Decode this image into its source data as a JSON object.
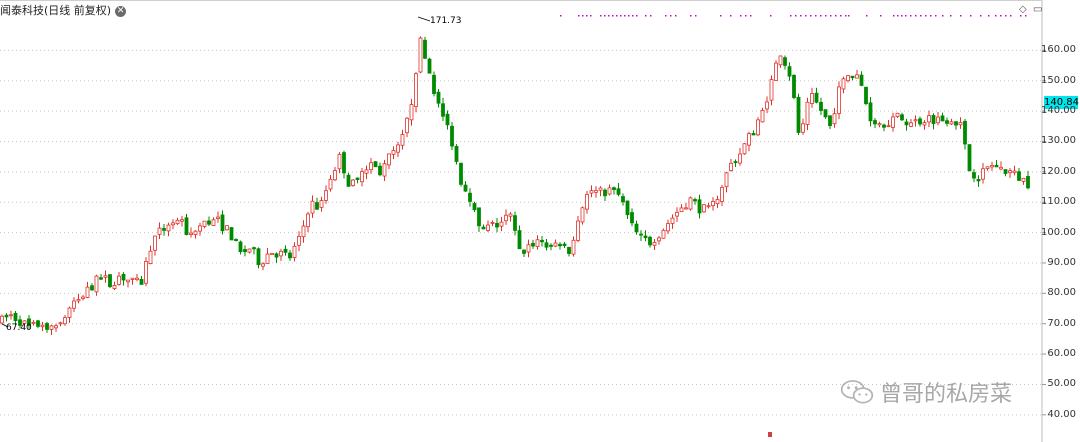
{
  "header": {
    "title": "闻泰科技(日线 前复权)",
    "close_icon": "close-icon"
  },
  "toolbar": {
    "diamond_icon": "diamond-icon",
    "window_icon": "window-icon"
  },
  "price_tag": {
    "value": "140.84",
    "color": "#00e5ee"
  },
  "watermark": {
    "text": "曾哥的私房菜",
    "icon": "wechat-icon"
  },
  "colors": {
    "up": "#e0302a",
    "down": "#008a00",
    "grid": "#c8c8c8",
    "marker": "#cc00cc"
  },
  "chart_data": {
    "type": "candlestick",
    "ylim": [
      35,
      170
    ],
    "yticks": [
      "40.00",
      "50.00",
      "60.00",
      "70.00",
      "80.00",
      "90.00",
      "100.00",
      "110.00",
      "120.00",
      "130.00",
      "140.00",
      "150.00",
      "160.00"
    ],
    "annotations": {
      "high": "171.73",
      "low": "67.40"
    },
    "y_values": {
      "anchors": [
        [
          0,
          70.5
        ],
        [
          10,
          73
        ],
        [
          20,
          71
        ],
        [
          30,
          68.5
        ],
        [
          40,
          70
        ],
        [
          50,
          69.5
        ],
        [
          60,
          70
        ],
        [
          70,
          75
        ],
        [
          80,
          78
        ],
        [
          90,
          82
        ],
        [
          100,
          85
        ],
        [
          110,
          83
        ],
        [
          120,
          86
        ],
        [
          130,
          84
        ],
        [
          140,
          82
        ],
        [
          150,
          95
        ],
        [
          160,
          100
        ],
        [
          170,
          104
        ],
        [
          180,
          103
        ],
        [
          190,
          99
        ],
        [
          200,
          102
        ],
        [
          210,
          104
        ],
        [
          220,
          103
        ],
        [
          230,
          100
        ],
        [
          240,
          93
        ],
        [
          250,
          95
        ],
        [
          260,
          90
        ],
        [
          270,
          94
        ],
        [
          280,
          93
        ],
        [
          290,
          92
        ],
        [
          300,
          98
        ],
        [
          310,
          110
        ],
        [
          320,
          108
        ],
        [
          330,
          118
        ],
        [
          340,
          125
        ],
        [
          350,
          115
        ],
        [
          360,
          118
        ],
        [
          370,
          123
        ],
        [
          380,
          120
        ],
        [
          390,
          125
        ],
        [
          400,
          128
        ],
        [
          410,
          140
        ],
        [
          420,
          163
        ],
        [
          430,
          152
        ],
        [
          440,
          140
        ],
        [
          450,
          133
        ],
        [
          460,
          118
        ],
        [
          470,
          112
        ],
        [
          480,
          100
        ],
        [
          490,
          102
        ],
        [
          500,
          103
        ],
        [
          510,
          106
        ],
        [
          520,
          93
        ],
        [
          530,
          96
        ],
        [
          540,
          98
        ],
        [
          550,
          95
        ],
        [
          560,
          97
        ],
        [
          570,
          94
        ],
        [
          580,
          108
        ],
        [
          590,
          114
        ],
        [
          600,
          113
        ],
        [
          610,
          114
        ],
        [
          620,
          112
        ],
        [
          630,
          103
        ],
        [
          640,
          98
        ],
        [
          650,
          97
        ],
        [
          660,
          100
        ],
        [
          670,
          104
        ],
        [
          680,
          108
        ],
        [
          690,
          111
        ],
        [
          700,
          108
        ],
        [
          710,
          107
        ],
        [
          720,
          114
        ],
        [
          730,
          122
        ],
        [
          740,
          126
        ],
        [
          750,
          132
        ],
        [
          760,
          137
        ],
        [
          770,
          148
        ],
        [
          780,
          160
        ],
        [
          790,
          152
        ],
        [
          800,
          130
        ],
        [
          810,
          145
        ],
        [
          820,
          141
        ],
        [
          830,
          135
        ],
        [
          840,
          148
        ],
        [
          850,
          153
        ],
        [
          860,
          150
        ],
        [
          870,
          138
        ],
        [
          880,
          136
        ],
        [
          890,
          137
        ],
        [
          900,
          138
        ],
        [
          910,
          136
        ],
        [
          920,
          137
        ],
        [
          930,
          138
        ],
        [
          940,
          137
        ],
        [
          950,
          138
        ],
        [
          960,
          136
        ],
        [
          970,
          120
        ],
        [
          980,
          119
        ],
        [
          990,
          122
        ],
        [
          1000,
          121
        ],
        [
          1010,
          120
        ],
        [
          1020,
          118
        ],
        [
          1030,
          116
        ]
      ]
    },
    "markers_y_row": "top",
    "markers_x": [
      560,
      578,
      582,
      586,
      590,
      600,
      604,
      608,
      612,
      616,
      620,
      624,
      628,
      632,
      636,
      645,
      650,
      665,
      670,
      675,
      690,
      695,
      720,
      730,
      740,
      745,
      750,
      770,
      790,
      795,
      800,
      805,
      810,
      815,
      820,
      825,
      830,
      835,
      840,
      845,
      848,
      866,
      880,
      893,
      897,
      901,
      905,
      910,
      915,
      920,
      925,
      930,
      935,
      942,
      950,
      960,
      970,
      980,
      988,
      995,
      1000,
      1005,
      1010,
      1020,
      1025
    ]
  }
}
